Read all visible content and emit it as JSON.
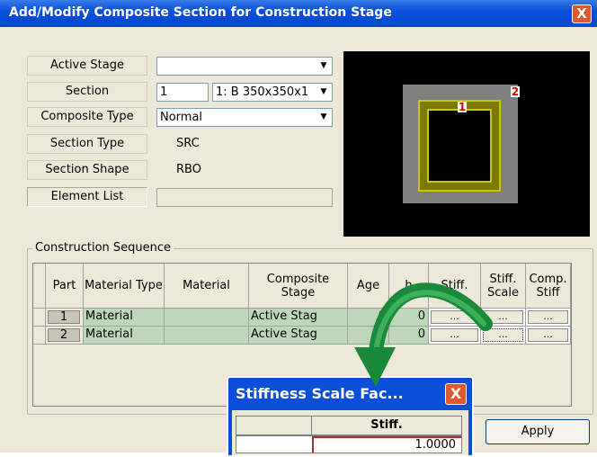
{
  "window": {
    "title": "Add/Modify Composite Section for Construction Stage",
    "close_label": "X"
  },
  "form": {
    "active_stage_label": "Active Stage",
    "active_stage_value": "",
    "section_label": "Section",
    "section_number": "1",
    "section_value": "1: B 350x350x1",
    "composite_type_label": "Composite Type",
    "composite_type_value": "Normal",
    "section_type_label": "Section Type",
    "section_type_value": "SRC",
    "section_shape_label": "Section Shape",
    "section_shape_value": "RBO",
    "element_list_label": "Element List",
    "element_list_value": ""
  },
  "preview": {
    "part1_label": "1",
    "part2_label": "2",
    "outer_color": "#808080",
    "inner_color": "#7a7a00"
  },
  "sequence": {
    "group_title": "Construction Sequence",
    "headers": {
      "part": "Part",
      "material_type": "Material Type",
      "material": "Material",
      "composite_stage": "Composite Stage",
      "age": "Age",
      "h": "h",
      "stiff": "Stiff.",
      "stiff_scale": "Stiff. Scale",
      "comp_stiff": "Comp. Stiff"
    },
    "rows": [
      {
        "part": "1",
        "material_type": "Material",
        "material": "",
        "composite_stage": "Active Stag",
        "age": "0",
        "h": "0",
        "stiff_btn": "...",
        "scale_btn": "...",
        "comp_btn": "..."
      },
      {
        "part": "2",
        "material_type": "Material",
        "material": "",
        "composite_stage": "Active Stag",
        "age": "0",
        "h": "0",
        "stiff_btn": "...",
        "scale_btn": "...",
        "comp_btn": "..."
      }
    ]
  },
  "buttons": {
    "apply": "Apply"
  },
  "popup": {
    "title": "Stiffness Scale Fac...",
    "close_label": "X",
    "header_col2": "Stiff.",
    "row1_value": "1.0000"
  },
  "arrow": {
    "color": "#1a8a3a"
  }
}
